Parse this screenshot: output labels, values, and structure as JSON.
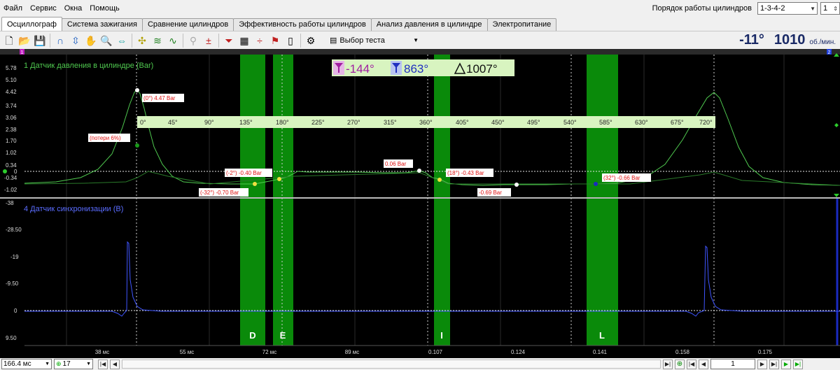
{
  "menu": [
    "Файл",
    "Сервис",
    "Окна",
    "Помощь"
  ],
  "cylinder_order": {
    "label": "Порядок работы цилиндров",
    "value": "1-3-4-2",
    "cylinder": "1"
  },
  "tabs": [
    {
      "label": "Осциллограф",
      "active": true
    },
    {
      "label": "Система зажигания",
      "active": false
    },
    {
      "label": "Сравнение цилиндров",
      "active": false
    },
    {
      "label": "Эффективность работы цилиндров",
      "active": false
    },
    {
      "label": "Анализ давления в цилиндре",
      "active": false
    },
    {
      "label": "Электропитание",
      "active": false
    }
  ],
  "toolbar": {
    "test_select_label": "Выбор теста"
  },
  "readout": {
    "angle": "-11°",
    "rpm": "1010",
    "rpm_unit": "об./мин."
  },
  "markers": {
    "m1": "1",
    "m2": "2"
  },
  "cursor_box": {
    "cursor1": "-144°",
    "cursor2": "863°",
    "delta": "1007°"
  },
  "channel1": {
    "title": "1 Датчик давления в цилиндре (Bar)",
    "y_ticks": [
      "5.78",
      "5.10",
      "4.42",
      "3.74",
      "3.06",
      "2.38",
      "1.70",
      "1.02",
      "0.34",
      "0",
      "-0.34",
      "-1.02"
    ],
    "angle_ticks": [
      "0°",
      "45°",
      "90°",
      "135°",
      "180°",
      "225°",
      "270°",
      "315°",
      "360°",
      "405°",
      "450°",
      "495°",
      "540°",
      "585°",
      "630°",
      "675°",
      "720°"
    ],
    "annotations": [
      {
        "id": "peak",
        "text": "(0°) 4.47 Bar"
      },
      {
        "id": "loss",
        "text": "(потери 6%)"
      },
      {
        "id": "a",
        "text": "(-2°) -0.40 Bar"
      },
      {
        "id": "b",
        "text": "(-32°) -0.70 Bar"
      },
      {
        "id": "c",
        "text": "0.06 Bar"
      },
      {
        "id": "d",
        "text": "(18°) -0.43 Bar"
      },
      {
        "id": "e",
        "text": "-0.69 Bar"
      },
      {
        "id": "f",
        "text": "(32°) -0.66 Bar"
      }
    ]
  },
  "channel2": {
    "title": "4 Датчик синхронизации (В)",
    "y_ticks": [
      "-38",
      "-28.50",
      "-19",
      "-9.50",
      "0",
      "9.50"
    ]
  },
  "zones": [
    "D",
    "E",
    "I",
    "L"
  ],
  "time_ticks": [
    "38 мс",
    "55 мс",
    "72 мс",
    "89 мс",
    "0.107",
    "0.124",
    "0.141",
    "0.158",
    "0.175"
  ],
  "status": {
    "timebase": "166.4 мс",
    "channel": "17",
    "page": "1"
  },
  "colors": {
    "pressure": "#4fc94f",
    "sync": "#3f55ff",
    "zone": "#0a8a0a",
    "label_text": "#e01010"
  },
  "icons": [
    "new-file-icon",
    "open-folder-icon",
    "save-icon",
    "zoom-icon",
    "hand-icon",
    "settings-icon",
    "auto-icon"
  ]
}
